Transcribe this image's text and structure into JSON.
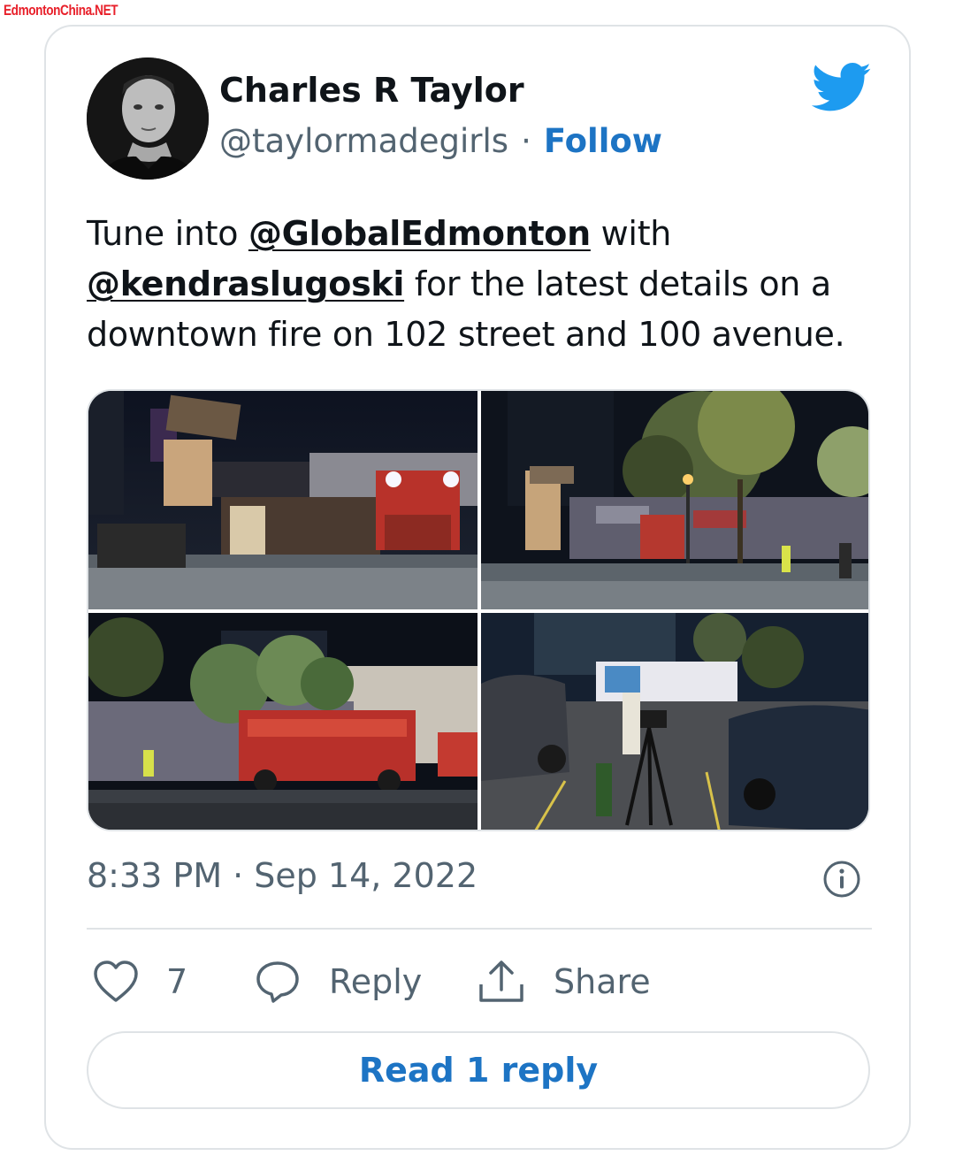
{
  "watermark": "EdmontonChina.NET",
  "author": {
    "name": "Charles R Taylor",
    "handle": "@taylormadegirls",
    "separator": "·",
    "follow_label": "Follow"
  },
  "tweet": {
    "text_1": "Tune into ",
    "mention_1": "@GlobalEdmonton",
    "text_2": " with ",
    "mention_2": "@kendraslugoski",
    "text_3": " for the latest details on a downtown fire on 102 street and 100 avenue."
  },
  "media": {
    "photos": [
      {
        "name": "photo-fire-truck-building-sign"
      },
      {
        "name": "photo-street-trees-fire-truck"
      },
      {
        "name": "photo-red-fire-engine-night"
      },
      {
        "name": "photo-news-camera-parking-lot"
      }
    ]
  },
  "meta": {
    "time": "8:33 PM",
    "separator": "·",
    "date": "Sep 14, 2022"
  },
  "actions": {
    "like_count": "7",
    "reply_label": "Reply",
    "share_label": "Share"
  },
  "footer": {
    "read_reply_label": "Read 1 reply"
  },
  "colors": {
    "accent": "#1d74c4",
    "twitter_blue": "#1d9bf0",
    "text": "#0f1419",
    "muted": "#536471",
    "border": "#dfe3e6",
    "watermark": "#e8202a"
  },
  "icons": [
    "twitter-bird-icon",
    "info-icon",
    "heart-icon",
    "reply-bubble-icon",
    "share-icon"
  ]
}
